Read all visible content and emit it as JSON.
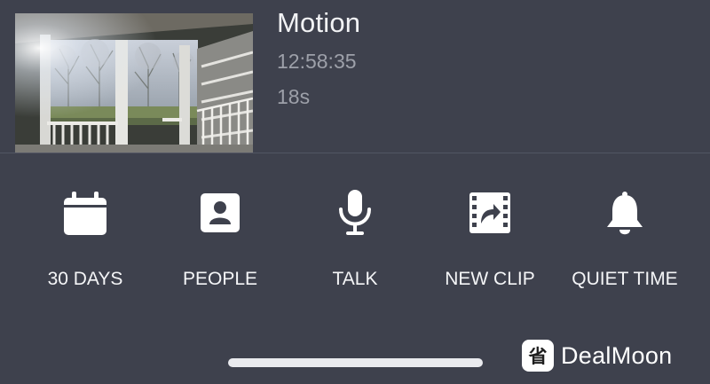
{
  "event": {
    "type": "Motion",
    "time": "12:58:35",
    "duration": "18s",
    "thumbnail_icon": "porch-camera-snapshot"
  },
  "actions": [
    {
      "label": "30 DAYS",
      "icon": "calendar-icon"
    },
    {
      "label": "PEOPLE",
      "icon": "person-card-icon"
    },
    {
      "label": "TALK",
      "icon": "microphone-icon"
    },
    {
      "label": "NEW CLIP",
      "icon": "film-share-icon"
    },
    {
      "label": "QUIET TIME",
      "icon": "bell-icon"
    }
  ],
  "watermark": {
    "text": "DealMoon",
    "logo_glyph": "省"
  },
  "colors": {
    "background": "#3e414d",
    "divider": "#525663",
    "primary_text": "#f2f3f5",
    "secondary_text": "#9da0a9",
    "icon": "#ffffff"
  }
}
